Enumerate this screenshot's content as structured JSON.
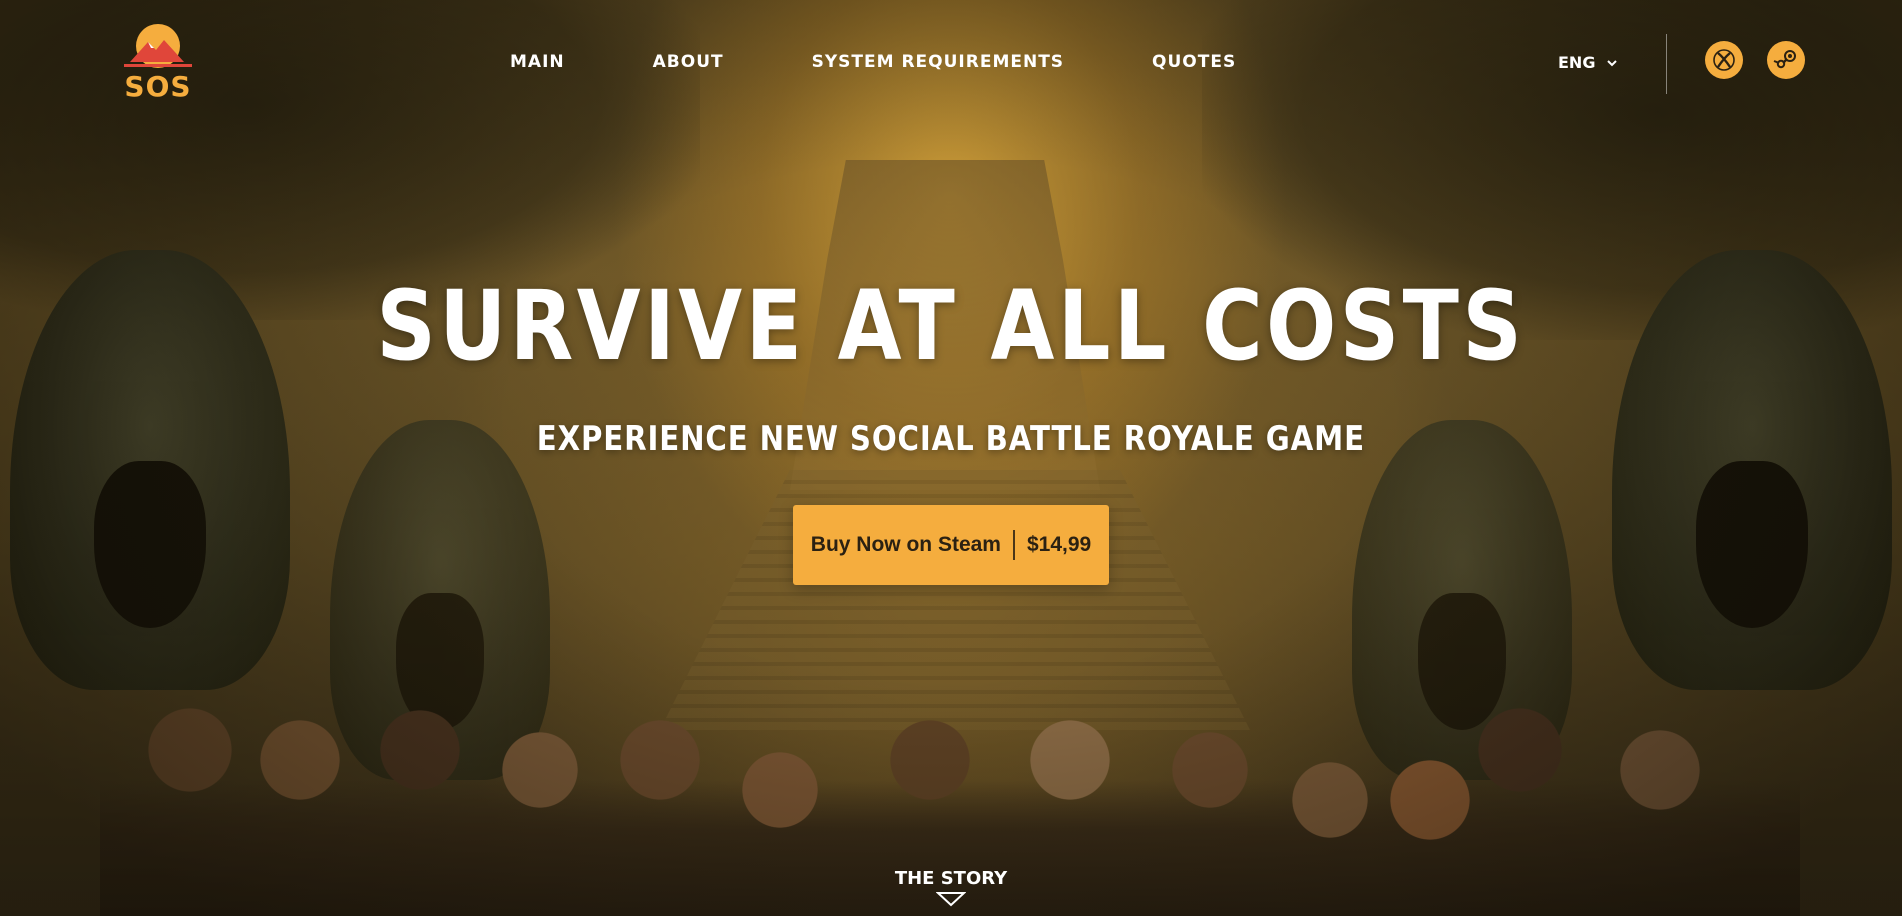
{
  "brand": {
    "logo_text": "SOS",
    "accent_color": "#f5ad3e",
    "logo_red": "#e0463a"
  },
  "nav": {
    "items": [
      {
        "label": "MAIN"
      },
      {
        "label": "ABOUT"
      },
      {
        "label": "SYSTEM REQUIREMENTS"
      },
      {
        "label": "QUOTES"
      }
    ]
  },
  "language": {
    "selected": "ENG",
    "icon": "chevron-down-icon"
  },
  "social": {
    "xbox_icon": "xbox-icon",
    "steam_icon": "steam-icon"
  },
  "hero": {
    "headline": "SURVIVE AT ALL COSTS",
    "subheadline": "EXPERIENCE NEW SOCIAL BATTLE ROYALE GAME",
    "buy_label": "Buy Now on Steam",
    "price": "$14,99",
    "story_label": "THE STORY",
    "story_icon": "triangle-down-icon"
  }
}
